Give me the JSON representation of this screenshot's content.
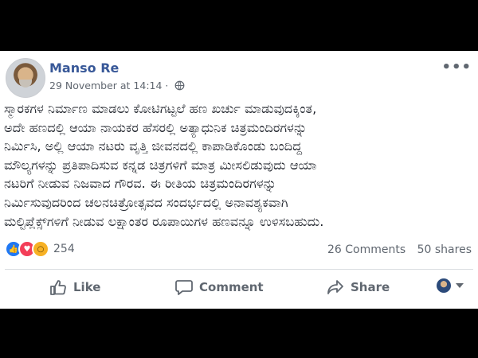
{
  "post": {
    "author": "Manso Re",
    "timestamp": "29 November at 14:14",
    "dot": "·",
    "more_label": "•••",
    "lines": [
      "ಸ್ಮಾರಕಗಳ ನಿರ್ಮಾಣ ಮಾಡಲು ಕೋಟಿಗಟ್ಟಲೆ ಹಣ ಖರ್ಚು ಮಾಡುವುದಕ್ಕಿಂತ,",
      "ಅದೇ ಹಣದಲ್ಲಿ ಆಯಾ ನಾಯಕರ ಹೆಸರಲ್ಲಿ ಅತ್ಯಾಧುನಿಕ ಚಿತ್ರಮಂದಿರಗಳನ್ನು",
      "ನಿರ್ಮಿಸಿ, ಅಲ್ಲಿ ಆಯಾ ನಟರು ವೃತ್ತಿ ಜೀವನದಲ್ಲಿ ಕಾಪಾಡಿಕೊಂಡು ಬಂದಿದ್ದ",
      "ಮೌಲ್ಯಗಳನ್ನು ಪ್ರತಿಪಾದಿಸುವ ಕನ್ನಡ ಚಿತ್ರಗಳಿಗೆ ಮಾತ್ರ ಮೀಸಲಿಡುವುದು ಆಯಾ",
      "ನಟರಿಗೆ ನೀಡುವ ನಿಜವಾದ ಗೌರವ. ಈ ರೀತಿಯ ಚಿತ್ರಮಂದಿರಗಳನ್ನು",
      "ನಿರ್ಮಿಸುವುದರಿಂದ ಚಲನಚಿತ್ರೋತ್ಸವದ ಸಂದರ್ಭದಲ್ಲಿ ಅನಾವಶ್ಯಕವಾಗಿ",
      "ಮಲ್ಟಿಪ್ಲೆಕ್ಸ್‌ಗಳಿಗೆ ನೀಡುವ ಲಕ್ಷಾಂತರ ರೂಪಾಯಿಗಳ ಹಣವನ್ನೂ ಉಳಿಸಬಹುದು."
    ]
  },
  "stats": {
    "reaction_count": "254",
    "comments": "26 Comments",
    "shares": "50 shares"
  },
  "actions": {
    "like": "Like",
    "comment": "Comment",
    "share": "Share"
  },
  "icons": {
    "globe": "globe-icon",
    "like_reaction": "like-reaction-icon",
    "love_reaction": "love-reaction-icon",
    "wow_reaction": "wow-reaction-icon",
    "like": "thumbs-up-icon",
    "comment": "speech-bubble-icon",
    "share": "share-arrow-icon",
    "caret": "chevron-down-icon"
  },
  "colors": {
    "author": "#385898",
    "secondary_text": "#606770",
    "like_blue": "#2078f4",
    "love_red": "#f33e58",
    "wow_yellow": "#f7b125"
  }
}
